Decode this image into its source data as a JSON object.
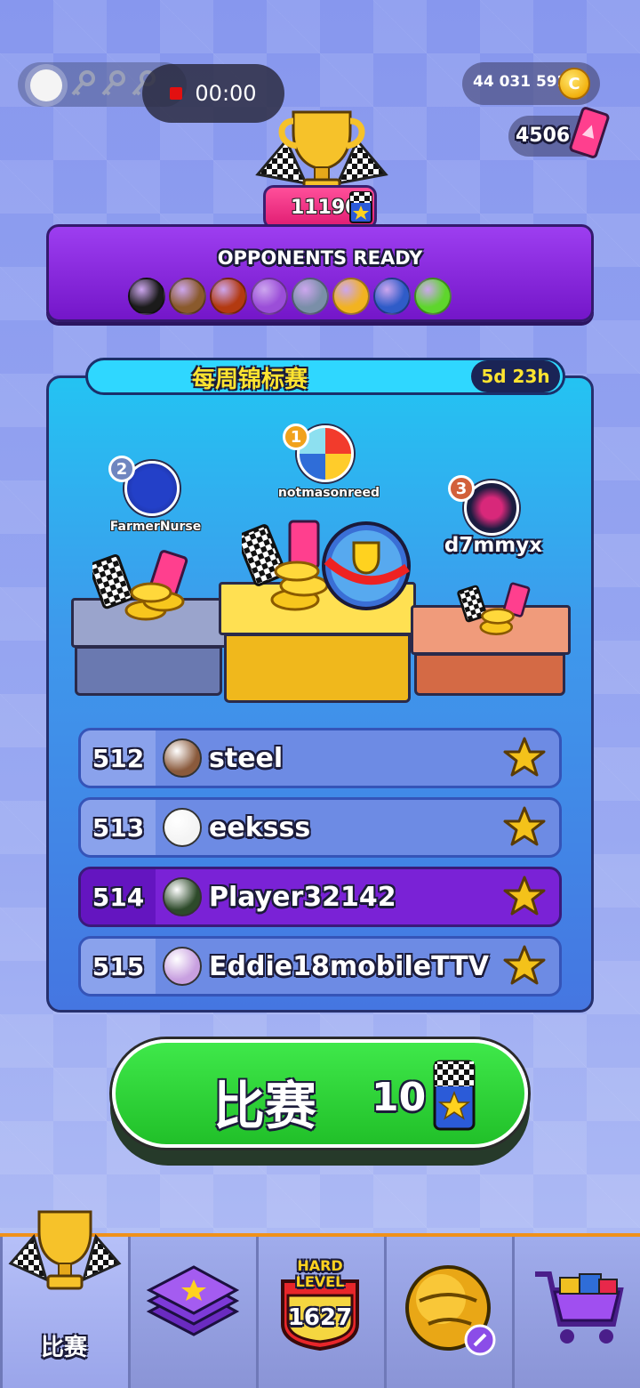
{
  "status_bar": {
    "recording_time": "00:00"
  },
  "currency": {
    "coins": "44 031 592",
    "coin_symbol": "C",
    "tickets": "4506"
  },
  "header": {
    "trophy_score": "11190"
  },
  "opponents": {
    "title": "OPPONENTS READY",
    "balls": [
      {
        "name": "eight-ball",
        "color": "#1b1b1b"
      },
      {
        "name": "coconut-ball",
        "color": "#8a5a2c"
      },
      {
        "name": "lava-ball",
        "color": "#b33a10"
      },
      {
        "name": "macaron-ball",
        "color": "#9b4ed8"
      },
      {
        "name": "cyber-ball",
        "color": "#7a8fa8"
      },
      {
        "name": "hardhat-ball",
        "color": "#f2b320"
      },
      {
        "name": "yarn-ball",
        "color": "#2f5cc8"
      },
      {
        "name": "apple-ball",
        "color": "#5ed62c"
      }
    ]
  },
  "tournament": {
    "title": "每周锦标赛",
    "time_left": "5d 23h",
    "podium": [
      {
        "rank": "1",
        "name": "notmasonreed",
        "rank_color": "#f1a21b"
      },
      {
        "rank": "2",
        "name": "FarmerNurse",
        "rank_color": "#6f86c0"
      },
      {
        "rank": "3",
        "name": "d7mmyx",
        "rank_color": "#d2603a"
      }
    ],
    "rows": [
      {
        "rank": "512",
        "name": "steel",
        "highlight": false
      },
      {
        "rank": "513",
        "name": "eeksss",
        "highlight": false
      },
      {
        "rank": "514",
        "name": "Player32142",
        "highlight": true
      },
      {
        "rank": "515",
        "name": "Eddie18mobileTTV",
        "highlight": false
      }
    ]
  },
  "play_button": {
    "label": "比赛",
    "cost": "10"
  },
  "nav": {
    "items": [
      {
        "label": "比赛",
        "icon": "trophy-icon",
        "active": true
      },
      {
        "label": "",
        "icon": "cards-icon",
        "active": false
      },
      {
        "label": "",
        "icon": "hard-level-icon",
        "active": false
      },
      {
        "label": "",
        "icon": "ball-customize-icon",
        "active": false
      },
      {
        "label": "",
        "icon": "shop-cart-icon",
        "active": false
      }
    ],
    "hard_level": {
      "tag": "HARD LEVEL",
      "number": "1627"
    }
  },
  "colors": {
    "accent_green": "#21c029",
    "highlight_purple": "#7a22d6",
    "row_blue": "#6d8be4",
    "gold": "#f4c21a"
  }
}
